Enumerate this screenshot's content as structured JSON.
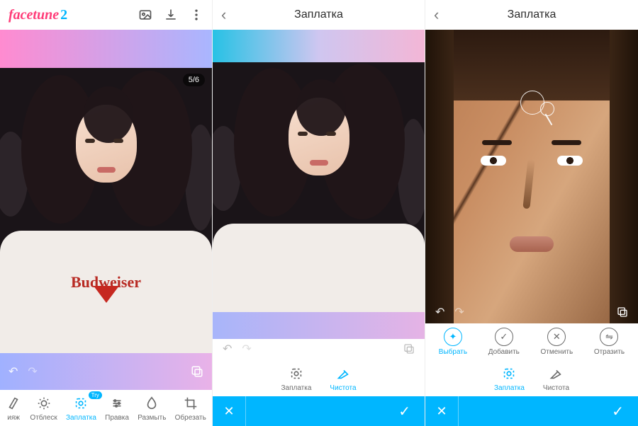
{
  "panel1": {
    "brand_a": "facetune",
    "brand_b": "2",
    "counter": "5/6",
    "shirt_logo": "Budweiser",
    "tools": [
      {
        "label": "ияж"
      },
      {
        "label": "Отблеск"
      },
      {
        "label": "Заплатка",
        "try": "Try"
      },
      {
        "label": "Правка"
      },
      {
        "label": "Размыть"
      },
      {
        "label": "Обрезать"
      }
    ]
  },
  "panel2": {
    "title": "Заплатка",
    "tools": [
      {
        "label": "Заплатка"
      },
      {
        "label": "Чистота"
      }
    ]
  },
  "panel3": {
    "title": "Заплатка",
    "selection": [
      {
        "label": "Выбрать"
      },
      {
        "label": "Добавить"
      },
      {
        "label": "Отменить"
      },
      {
        "label": "Отразить"
      }
    ],
    "tools": [
      {
        "label": "Заплатка"
      },
      {
        "label": "Чистота"
      }
    ]
  }
}
